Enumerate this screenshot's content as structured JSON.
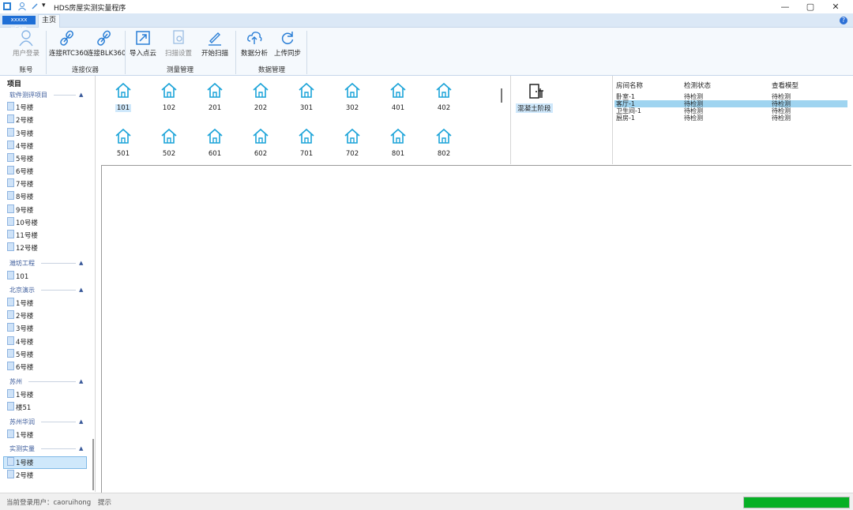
{
  "window": {
    "title": "HDS房屋实测实量程序"
  },
  "window_controls": {
    "minimize": "—",
    "maximize": "▢",
    "close": "✕"
  },
  "ribbon": {
    "logo_tab": "xxxxx xCom",
    "tab_home": "主页",
    "buttons": {
      "user_login": "用户登录",
      "connect_rtc360": "连接RTC360",
      "connect_blk360": "连接BLK360",
      "import_cloud": "导入点云",
      "scan_settings": "扫描设置",
      "start_scan": "开始扫描",
      "data_analysis": "数据分析",
      "upload_sync": "上传同步"
    },
    "groups": {
      "account": "账号",
      "connect_device": "连接仪器",
      "measure_mgmt": "测量管理",
      "data_mgmt": "数据管理"
    }
  },
  "left_panel": {
    "header": "项目",
    "groups": [
      {
        "name": "软件测评项目",
        "items": [
          "1号楼",
          "2号楼",
          "3号楼",
          "4号楼",
          "5号楼",
          "6号楼",
          "7号楼",
          "8号楼",
          "9号楼",
          "10号楼",
          "11号楼",
          "12号楼"
        ]
      },
      {
        "name": "潍坊工程",
        "items": [
          "101"
        ]
      },
      {
        "name": "北京演示",
        "items": [
          "1号楼",
          "2号楼",
          "3号楼",
          "4号楼",
          "5号楼",
          "6号楼"
        ]
      },
      {
        "name": "苏州",
        "items": [
          "1号楼",
          "楼51"
        ]
      },
      {
        "name": "苏州华润",
        "items": [
          "1号楼"
        ]
      },
      {
        "name": "实测实量",
        "items": [
          "1号楼",
          "2号楼"
        ]
      }
    ],
    "selected": "实测实量/1号楼"
  },
  "rooms": {
    "row1": [
      "101",
      "102",
      "201",
      "202",
      "301",
      "302",
      "401",
      "402"
    ],
    "row2": [
      "501",
      "502",
      "601",
      "602",
      "701",
      "702",
      "801",
      "802"
    ],
    "selected": "101"
  },
  "stage": {
    "label": "混凝土阶段"
  },
  "room_table": {
    "headers": [
      "房间名称",
      "检测状态",
      "查看模型"
    ],
    "rows": [
      [
        "卧室-1",
        "待检测",
        "待检测"
      ],
      [
        "客厅-1",
        "待检测",
        "待检测"
      ],
      [
        "卫生间-1",
        "待检测",
        "待检测"
      ],
      [
        "厨房-1",
        "待检测",
        "待检测"
      ]
    ],
    "selected_row": 1
  },
  "status": {
    "user_text": "当前登录用户：caoruihong",
    "hint": "提示",
    "progress": 1.0,
    "progress_color": "#06b025"
  },
  "colors": {
    "accent": "#1aa3d8",
    "selection": "#cfe8fb",
    "ribbon_bg": "#f5f9fd"
  }
}
